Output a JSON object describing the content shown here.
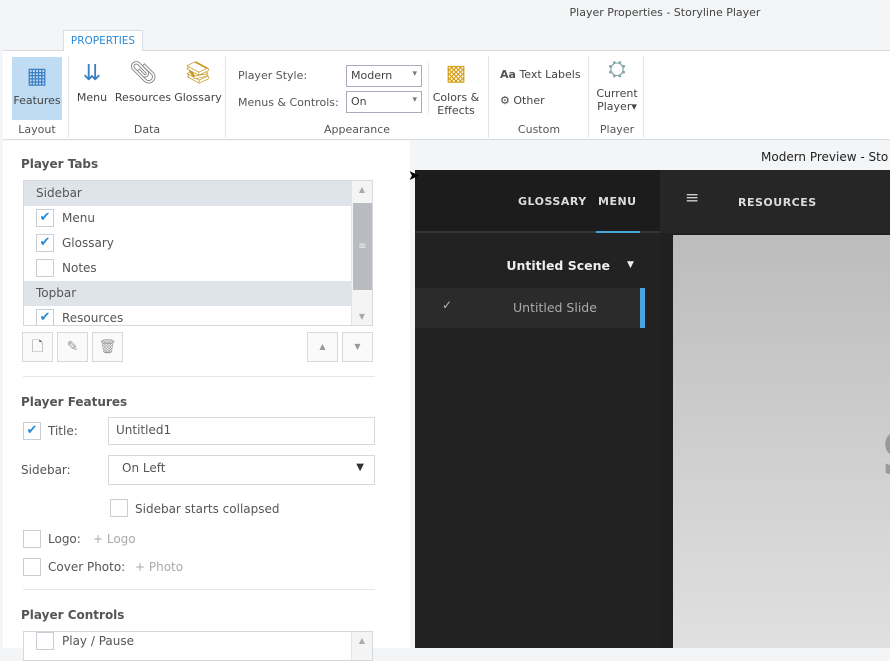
{
  "window": {
    "title": "Player Properties - Storyline Player"
  },
  "ribbon": {
    "tab": "PROPERTIES",
    "groups": {
      "layout": "Layout",
      "data": "Data",
      "appearance": "Appearance",
      "custom": "Custom",
      "player": "Player"
    },
    "features": "Features",
    "menu": "Menu",
    "resources": "Resources",
    "glossary": "Glossary",
    "player_style_label": "Player Style:",
    "player_style_value": "Modern",
    "menus_controls_label": "Menus & Controls:",
    "menus_controls_value": "On",
    "colors_effects": "Colors &",
    "colors_effects2": "Effects",
    "text_labels": "Text Labels",
    "text_labels_prefix": "Aa",
    "other": "Other",
    "current_player": "Current",
    "current_player2": "Player"
  },
  "player_tabs": {
    "heading": "Player Tabs",
    "rows": [
      {
        "type": "header",
        "label": "Sidebar"
      },
      {
        "type": "item",
        "label": "Menu",
        "checked": true
      },
      {
        "type": "item",
        "label": "Glossary",
        "checked": true
      },
      {
        "type": "item",
        "label": "Notes",
        "checked": false
      },
      {
        "type": "header",
        "label": "Topbar"
      },
      {
        "type": "item",
        "label": "Resources",
        "checked": true
      }
    ]
  },
  "player_features": {
    "heading": "Player Features",
    "title_label": "Title:",
    "title_value": "Untitled1",
    "title_checked": true,
    "sidebar_label": "Sidebar:",
    "sidebar_value": "On Left",
    "collapsed_label": "Sidebar starts collapsed",
    "logo_label": "Logo:",
    "logo_add": "+ Logo",
    "cover_label": "Cover Photo:",
    "cover_add": "+ Photo"
  },
  "player_controls": {
    "heading": "Player Controls",
    "first_item": "Play / Pause"
  },
  "preview": {
    "title": "Modern Preview - Sto",
    "tabs": [
      "GLOSSARY",
      "MENU"
    ],
    "resources": "RESOURCES",
    "scene": "Untitled Scene",
    "slide": "Untitled Slide",
    "slide_partial_text": "S",
    "accent": "#4aa3df"
  }
}
